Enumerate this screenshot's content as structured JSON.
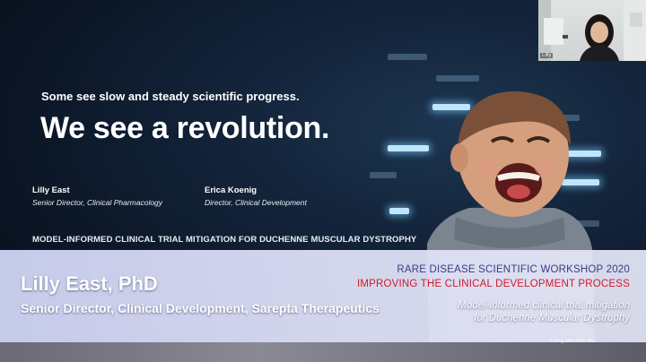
{
  "slide": {
    "tagline": "Some see slow and steady scientific progress.",
    "headline": "We see a revolution.",
    "presenters": [
      {
        "name": "Lilly East",
        "role": "Senior Director, Clinical Pharmacology"
      },
      {
        "name": "Erica Koenig",
        "role": "Director, Clinical Development"
      }
    ],
    "subtitle": "MODEL-INFORMED CLINICAL TRIAL MITIGATION FOR DUCHENNE MUSCULAR DYSTROPHY"
  },
  "lower_third": {
    "speaker_name": "Lilly East, PhD",
    "speaker_title": "Senior Director, Clinical Development, Sarepta Therapeutics",
    "workshop": "RARE DISEASE SCIENTIFIC WORKSHOP 2020",
    "process": "IMPROVING THE CLINICAL DEVELOPMENT PROCESS",
    "topic_line1": "Model-informed clinical trial mitigation",
    "topic_line2": "for Duchenne Muscular Dystrophy"
  },
  "footer_text": "Living with MFS life",
  "webcam": {
    "label": "Lilly"
  },
  "colors": {
    "workshop": "#3b3b82",
    "process": "#d01a2a",
    "band": "#cdd2f2",
    "bars": "#bfe6ff"
  }
}
